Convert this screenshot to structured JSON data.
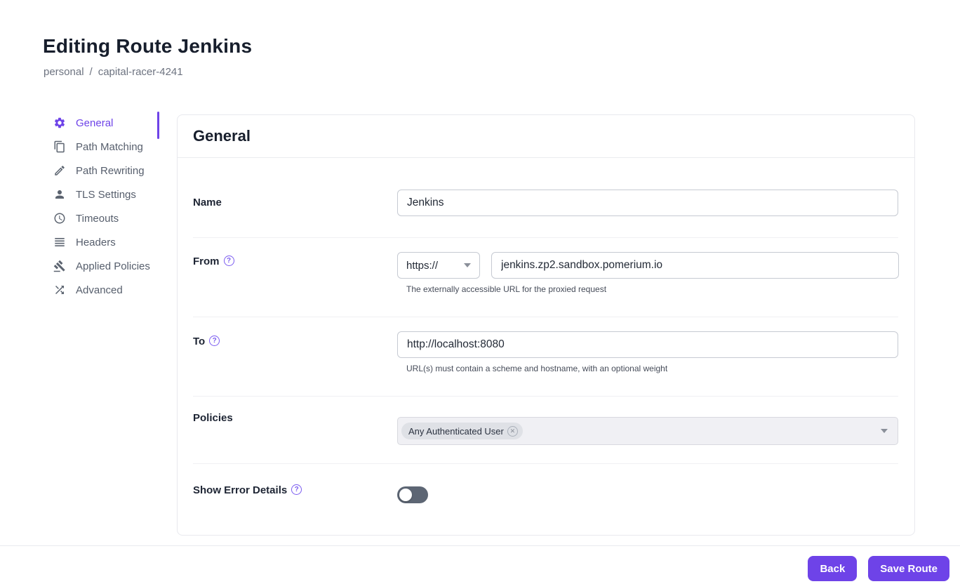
{
  "colors": {
    "accent": "#6e43e8",
    "toggle_track_off": "#5d6674"
  },
  "page": {
    "title": "Editing Route Jenkins",
    "breadcrumb": [
      "personal",
      "capital-racer-4241"
    ],
    "breadcrumb_separator": "/"
  },
  "sidebar": {
    "items": [
      {
        "label": "General",
        "icon": "gear-icon",
        "active": true
      },
      {
        "label": "Path Matching",
        "icon": "copy-icon",
        "active": false
      },
      {
        "label": "Path Rewriting",
        "icon": "pencil-icon",
        "active": false
      },
      {
        "label": "TLS Settings",
        "icon": "person-icon",
        "active": false
      },
      {
        "label": "Timeouts",
        "icon": "clock-icon",
        "active": false
      },
      {
        "label": "Headers",
        "icon": "list-icon",
        "active": false
      },
      {
        "label": "Applied Policies",
        "icon": "gavel-icon",
        "active": false
      },
      {
        "label": "Advanced",
        "icon": "shuffle-icon",
        "active": false
      }
    ]
  },
  "panel": {
    "title": "General",
    "name": {
      "label": "Name",
      "value": "Jenkins"
    },
    "from": {
      "label": "From",
      "scheme": "https://",
      "host": "jenkins.zp2.sandbox.pomerium.io",
      "helper": "The externally accessible URL for the proxied request"
    },
    "to": {
      "label": "To",
      "value": "http://localhost:8080",
      "helper": "URL(s) must contain a scheme and hostname, with an optional weight"
    },
    "policies": {
      "label": "Policies",
      "chips": [
        "Any Authenticated User"
      ]
    },
    "show_error_details": {
      "label": "Show Error Details",
      "enabled": false
    }
  },
  "footer": {
    "back": "Back",
    "save": "Save Route"
  }
}
